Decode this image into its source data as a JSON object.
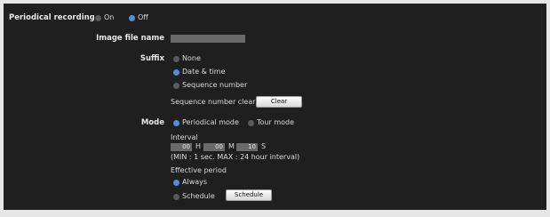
{
  "periodical_recording": {
    "label": "Periodical recording",
    "options": [
      {
        "label": "On",
        "selected": false
      },
      {
        "label": "Off",
        "selected": true
      }
    ]
  },
  "image_file_name": {
    "label": "Image file name",
    "value": ""
  },
  "suffix": {
    "label": "Suffix",
    "options": [
      {
        "label": "None",
        "selected": false
      },
      {
        "label": "Date & time",
        "selected": true
      },
      {
        "label": "Sequence number",
        "selected": false
      }
    ],
    "sequence_clear_label": "Sequence number clear",
    "clear_button": "Clear"
  },
  "mode": {
    "label": "Mode",
    "options": [
      {
        "label": "Periodical mode",
        "selected": true
      },
      {
        "label": "Tour mode",
        "selected": false
      }
    ],
    "interval": {
      "label": "Interval",
      "hours": "00",
      "hours_unit": "H",
      "minutes": "00",
      "minutes_unit": "M",
      "seconds": "10",
      "seconds_unit": "S",
      "note": "(MIN : 1 sec. MAX : 24 hour interval)"
    },
    "effective_period": {
      "label": "Effective period",
      "options": [
        {
          "label": "Always",
          "selected": true
        },
        {
          "label": "Schedule",
          "selected": false
        }
      ],
      "schedule_button": "Schedule"
    }
  },
  "colors": {
    "panel_bg": "#1f1f1f",
    "accent": "#4f8ee0",
    "page_bg": "#e6e6e6"
  }
}
